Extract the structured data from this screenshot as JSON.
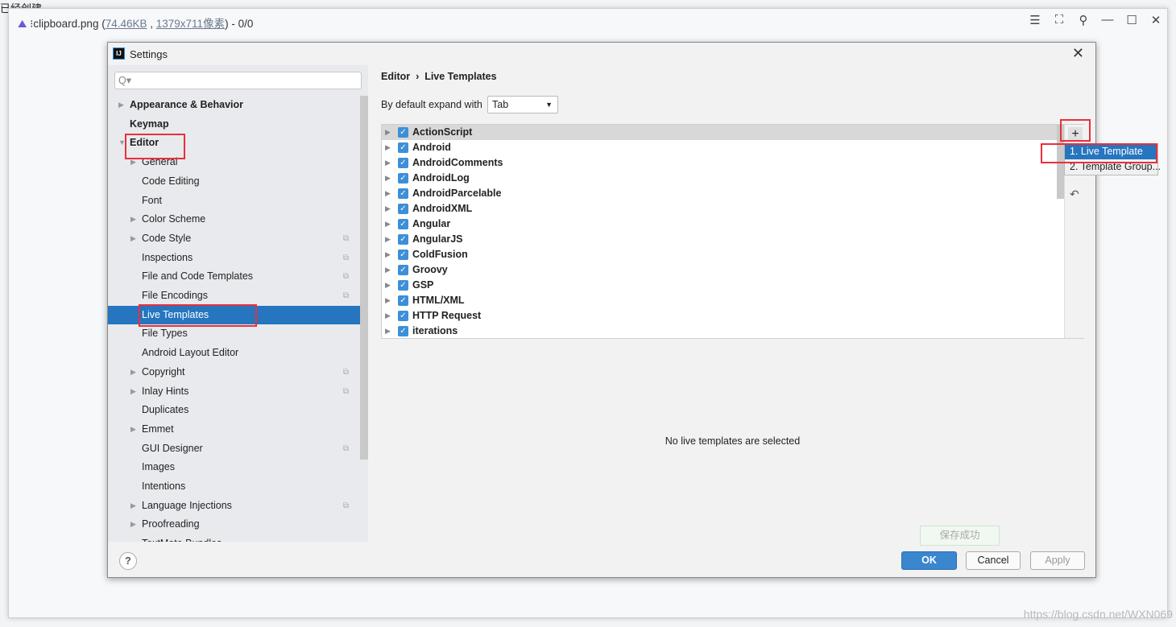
{
  "viewer": {
    "filename": "clipboard.png",
    "size": "74.46KB",
    "dims": "1379x711像素",
    "counter": "0/0",
    "bg_text": "已经创建..."
  },
  "dialog": {
    "title": "Settings",
    "close": "✕",
    "search_placeholder": "Q▾",
    "tree": [
      {
        "label": "Appearance & Behavior",
        "bold": true,
        "arrow": "▶",
        "level": 0
      },
      {
        "label": "Keymap",
        "bold": true,
        "level": 0
      },
      {
        "label": "Editor",
        "bold": true,
        "arrow": "▼",
        "level": 0
      },
      {
        "label": "General",
        "arrow": "▶",
        "level": 1
      },
      {
        "label": "Code Editing",
        "level": 1
      },
      {
        "label": "Font",
        "level": 1
      },
      {
        "label": "Color Scheme",
        "arrow": "▶",
        "level": 1
      },
      {
        "label": "Code Style",
        "arrow": "▶",
        "level": 1,
        "copy": true
      },
      {
        "label": "Inspections",
        "level": 1,
        "copy": true
      },
      {
        "label": "File and Code Templates",
        "level": 1,
        "copy": true
      },
      {
        "label": "File Encodings",
        "level": 1,
        "copy": true
      },
      {
        "label": "Live Templates",
        "level": 1,
        "selected": true
      },
      {
        "label": "File Types",
        "level": 1
      },
      {
        "label": "Android Layout Editor",
        "level": 1
      },
      {
        "label": "Copyright",
        "arrow": "▶",
        "level": 1,
        "copy": true
      },
      {
        "label": "Inlay Hints",
        "arrow": "▶",
        "level": 1,
        "copy": true
      },
      {
        "label": "Duplicates",
        "level": 1
      },
      {
        "label": "Emmet",
        "arrow": "▶",
        "level": 1
      },
      {
        "label": "GUI Designer",
        "level": 1,
        "copy": true
      },
      {
        "label": "Images",
        "level": 1
      },
      {
        "label": "Intentions",
        "level": 1
      },
      {
        "label": "Language Injections",
        "arrow": "▶",
        "level": 1,
        "copy": true
      },
      {
        "label": "Proofreading",
        "arrow": "▶",
        "level": 1
      },
      {
        "label": "TextMate Bundles",
        "level": 1
      }
    ],
    "breadcrumb": {
      "parent": "Editor",
      "sep": "›",
      "current": "Live Templates"
    },
    "expand_label": "By default expand with",
    "expand_value": "Tab",
    "templates": [
      "ActionScript",
      "Android",
      "AndroidComments",
      "AndroidLog",
      "AndroidParcelable",
      "AndroidXML",
      "Angular",
      "AngularJS",
      "ColdFusion",
      "Groovy",
      "GSP",
      "HTML/XML",
      "HTTP Request",
      "iterations"
    ],
    "empty_text": "No live templates are selected",
    "popup": [
      "1. Live Template",
      "2. Template Group..."
    ],
    "buttons": {
      "ok": "OK",
      "cancel": "Cancel",
      "apply": "Apply",
      "help": "?"
    },
    "toast": "保存成功"
  },
  "watermark": "https://blog.csdn.net/WXN069",
  "colors": {
    "selection": "#2675bf",
    "highlight_box": "#e8303a",
    "checkbox": "#3d8fd8"
  }
}
